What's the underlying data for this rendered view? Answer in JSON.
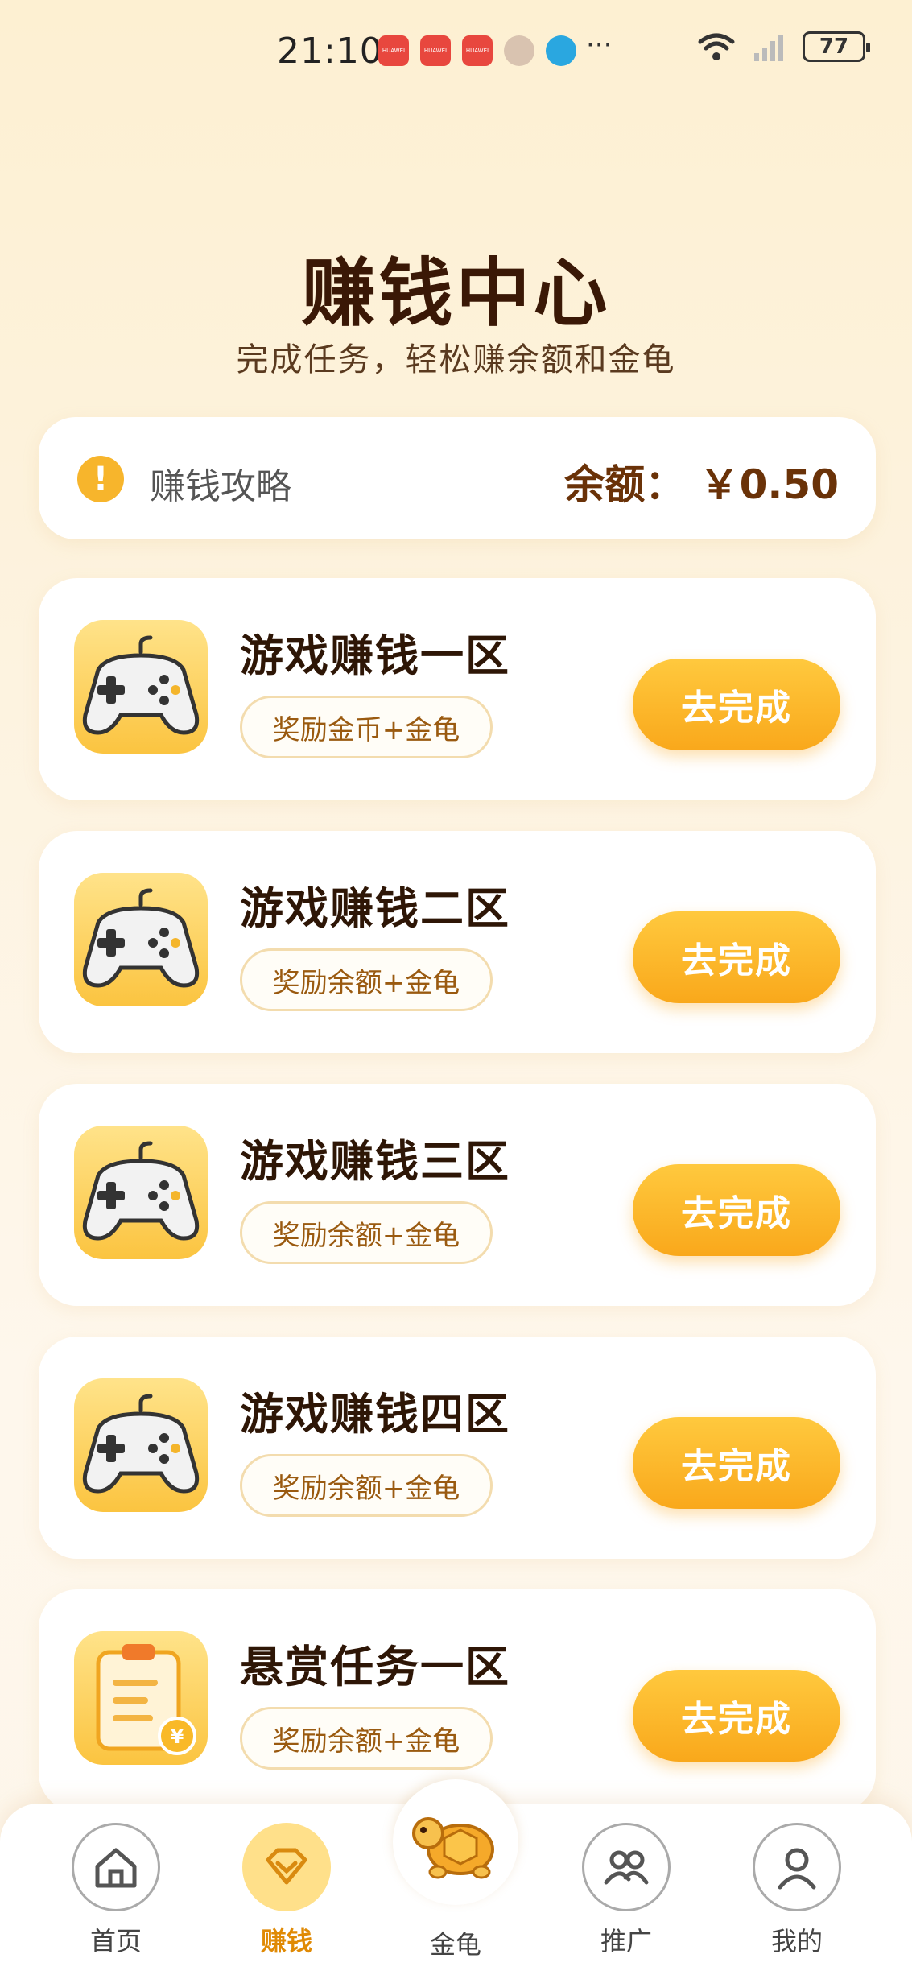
{
  "status_bar": {
    "time": "21:10",
    "battery": "77",
    "notif_label": "HUAWEI",
    "more": "···"
  },
  "header": {
    "title": "赚钱中心",
    "subtitle": "完成任务，轻松赚余额和金龟"
  },
  "balance_bar": {
    "guide_label": "赚钱攻略",
    "balance_label": "余额：",
    "balance_value": "￥0.50"
  },
  "tasks": [
    {
      "title": "游戏赚钱一区",
      "reward": "奖励金币+金龟",
      "button": "去完成",
      "icon": "gamepad-icon"
    },
    {
      "title": "游戏赚钱二区",
      "reward": "奖励余额+金龟",
      "button": "去完成",
      "icon": "gamepad-icon"
    },
    {
      "title": "游戏赚钱三区",
      "reward": "奖励余额+金龟",
      "button": "去完成",
      "icon": "gamepad-icon"
    },
    {
      "title": "游戏赚钱四区",
      "reward": "奖励余额+金龟",
      "button": "去完成",
      "icon": "gamepad-icon"
    },
    {
      "title": "悬赏任务一区",
      "reward": "奖励余额+金龟",
      "button": "去完成",
      "icon": "clipboard-coin-icon"
    }
  ],
  "nav": {
    "items": [
      {
        "label": "首页",
        "icon": "home-icon"
      },
      {
        "label": "赚钱",
        "icon": "diamond-icon"
      },
      {
        "label": "金龟",
        "icon": "turtle-icon"
      },
      {
        "label": "推广",
        "icon": "people-icon"
      },
      {
        "label": "我的",
        "icon": "user-icon"
      }
    ],
    "active_index": 1
  },
  "colors": {
    "accent": "#f9a81b",
    "title_brown": "#3a1806",
    "balance_brown": "#6a3208",
    "active_nav": "#e08a05"
  }
}
